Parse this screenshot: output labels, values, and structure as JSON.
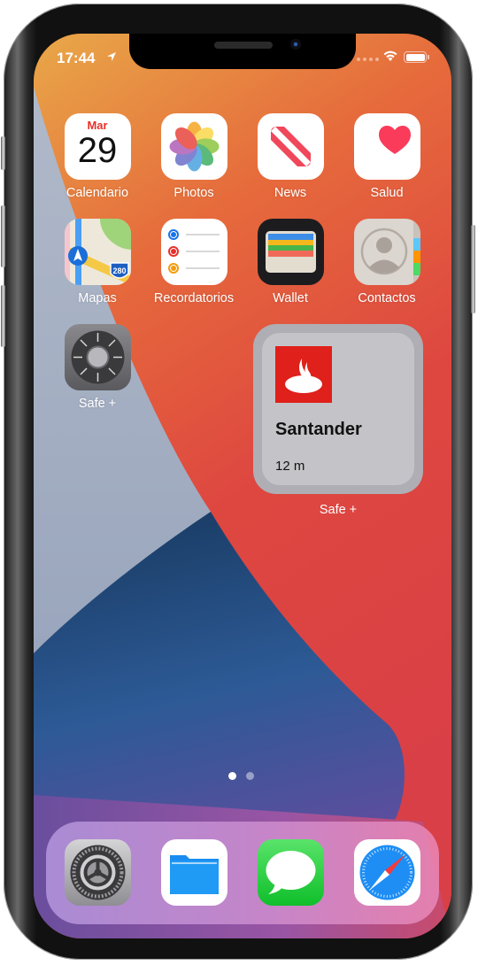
{
  "status_bar": {
    "time": "17:44",
    "location_icon": "location-arrow-icon",
    "wifi_icon": "wifi-icon",
    "battery_icon": "battery-icon"
  },
  "home": {
    "row1": [
      {
        "name": "Calendario",
        "icon": "calendar-icon",
        "month": "Mar",
        "day": "29"
      },
      {
        "name": "Photos",
        "icon": "photos-icon"
      },
      {
        "name": "News",
        "icon": "news-icon"
      },
      {
        "name": "Salud",
        "icon": "health-icon"
      }
    ],
    "row2": [
      {
        "name": "Mapas",
        "icon": "maps-icon",
        "shield": "280"
      },
      {
        "name": "Recordatorios",
        "icon": "reminders-icon"
      },
      {
        "name": "Wallet",
        "icon": "wallet-icon"
      },
      {
        "name": "Contactos",
        "icon": "contacts-icon"
      }
    ],
    "row3": [
      {
        "name": "Safe +",
        "icon": "safe-icon"
      }
    ],
    "widget": {
      "title": "Santander",
      "time": "12 m",
      "label": "Safe +",
      "logo": "santander-logo-icon",
      "brand_color": "#e0201a"
    }
  },
  "page_indicator": {
    "pages": 2,
    "current": 1
  },
  "dock": [
    {
      "name": "Settings",
      "icon": "settings-icon"
    },
    {
      "name": "Files",
      "icon": "files-icon"
    },
    {
      "name": "Messages",
      "icon": "messages-icon"
    },
    {
      "name": "Safari",
      "icon": "safari-icon"
    }
  ]
}
